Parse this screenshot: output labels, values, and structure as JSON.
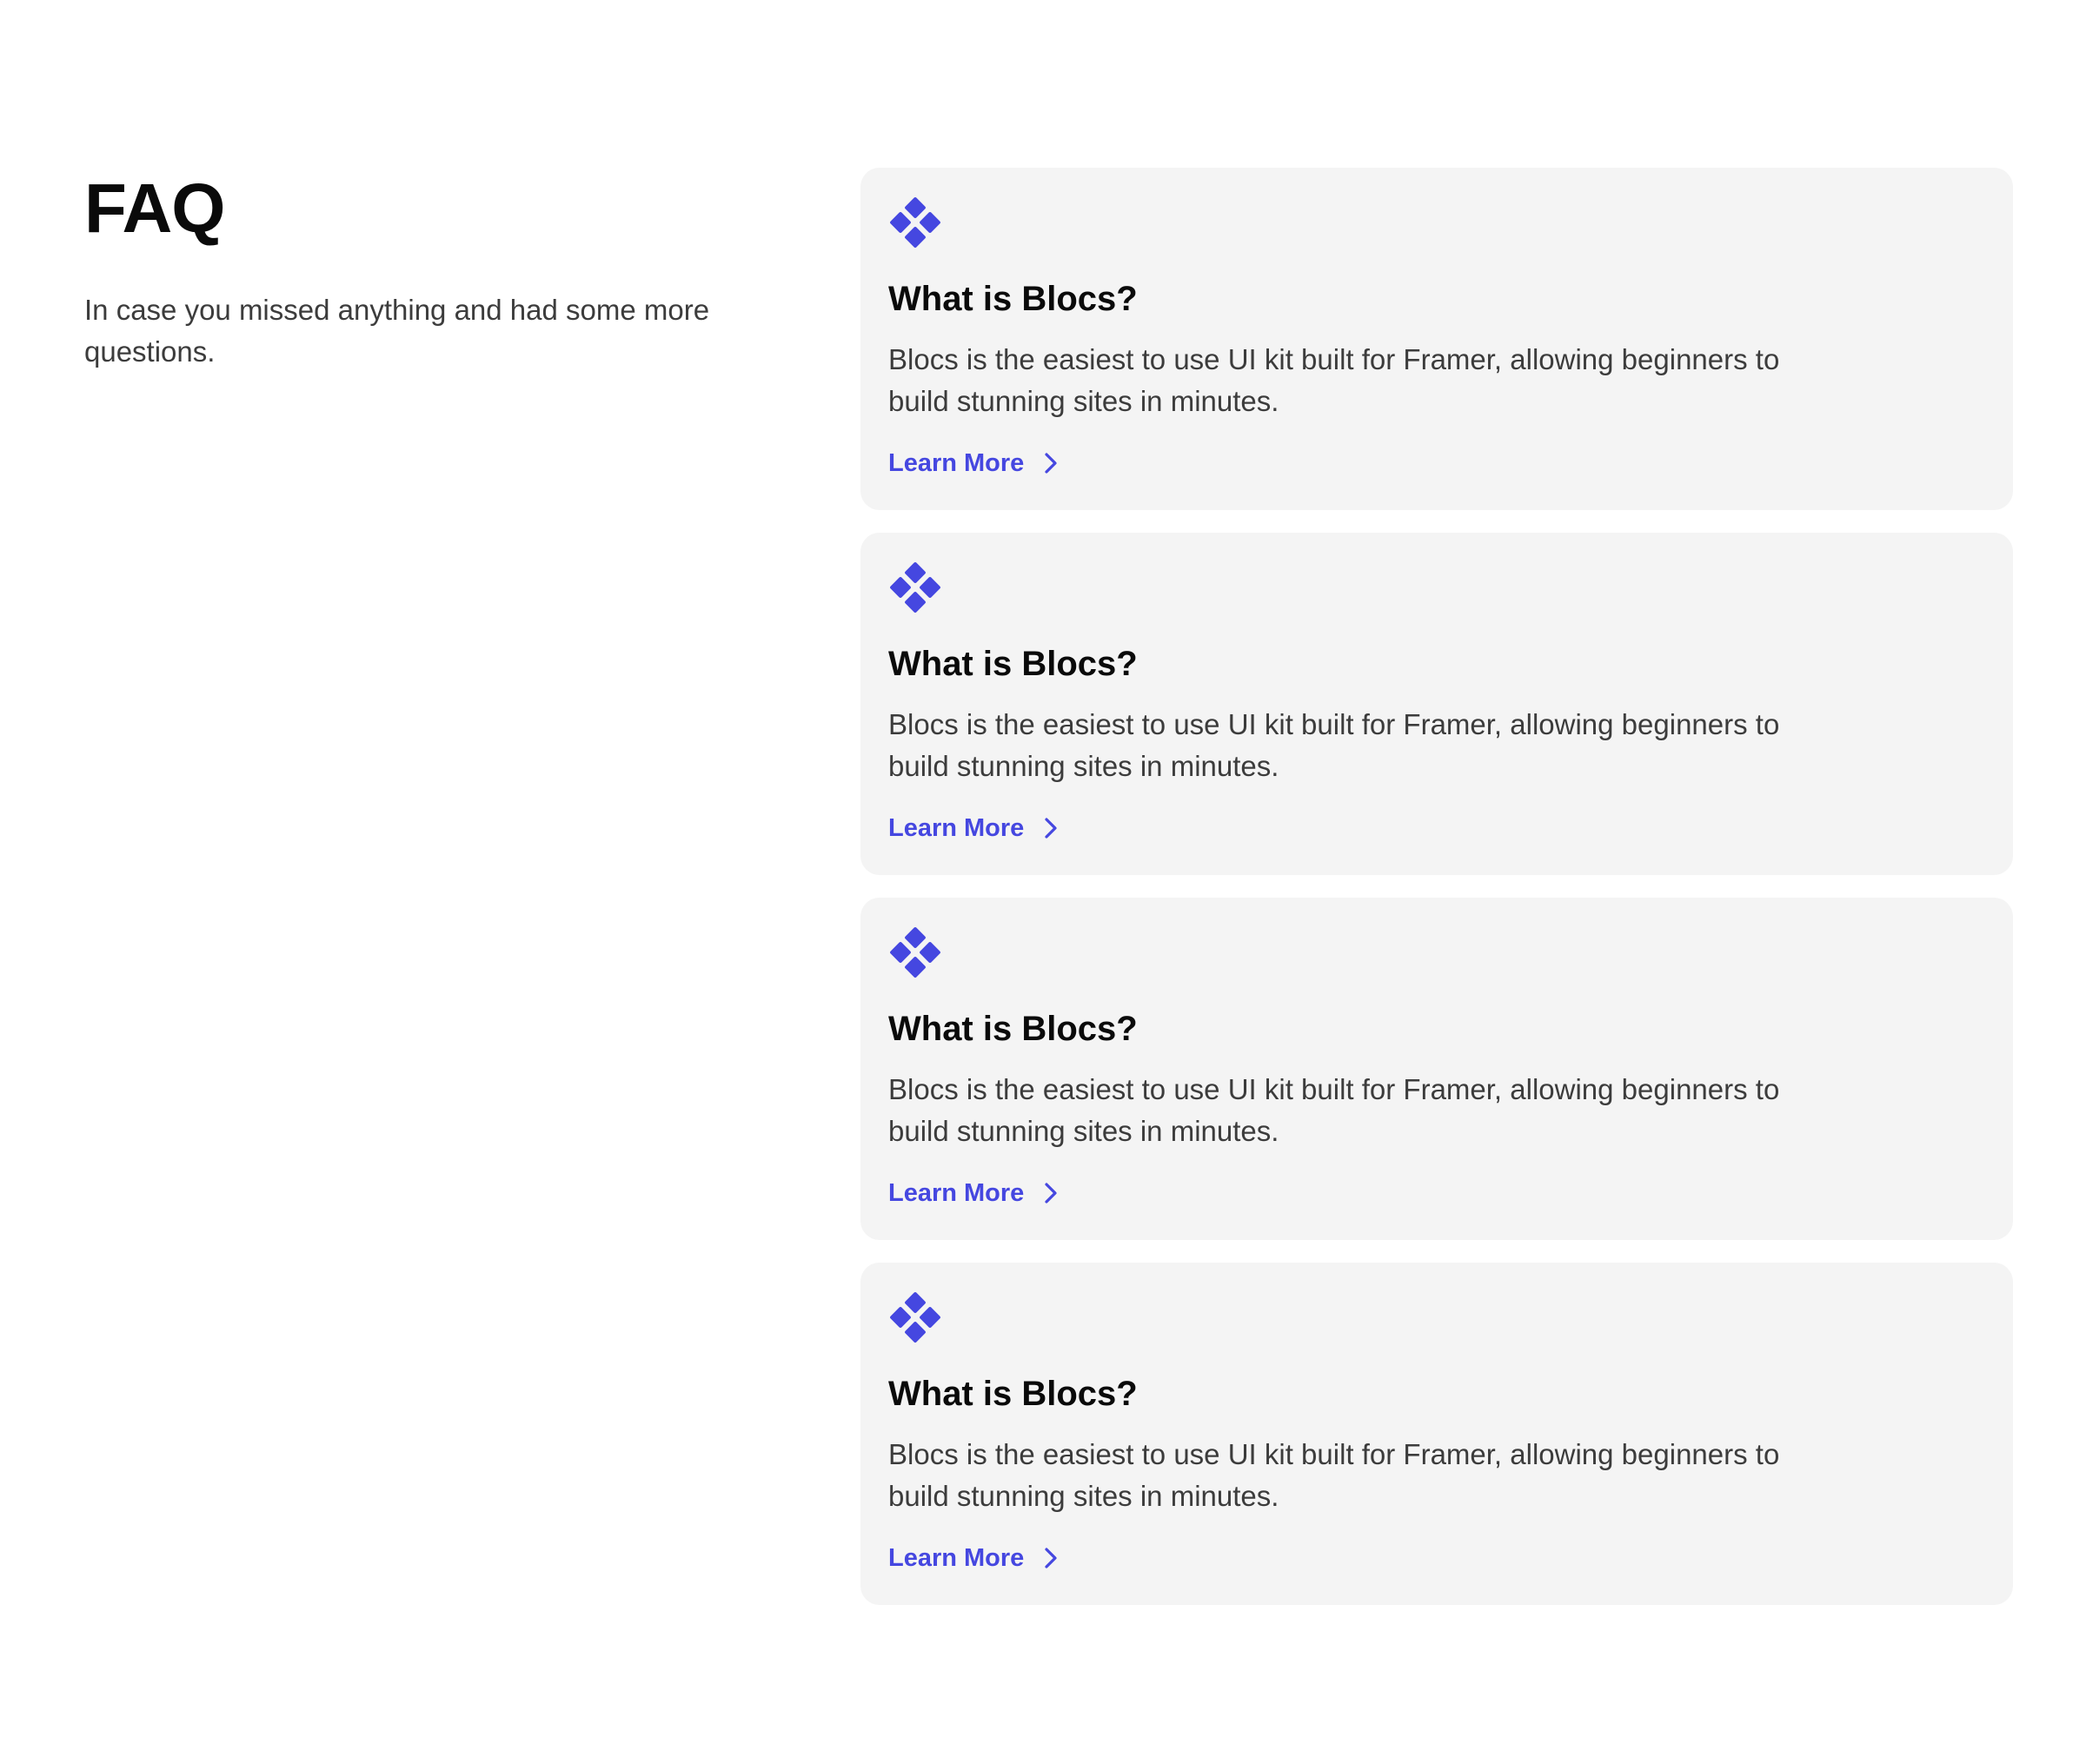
{
  "header": {
    "title": "FAQ",
    "subtitle": "In case you missed anything and had some more questions."
  },
  "accent_color": "#4547e0",
  "faq": [
    {
      "icon": "diamond-cluster-icon",
      "question": "What is Blocs?",
      "answer": "Blocs is the easiest to use UI kit built for Framer, allowing beginners to build stunning sites in minutes.",
      "link_label": "Learn More"
    },
    {
      "icon": "diamond-cluster-icon",
      "question": "What is Blocs?",
      "answer": "Blocs is the easiest to use UI kit built for Framer, allowing beginners to build stunning sites in minutes.",
      "link_label": "Learn More"
    },
    {
      "icon": "diamond-cluster-icon",
      "question": "What is Blocs?",
      "answer": "Blocs is the easiest to use UI kit built for Framer, allowing beginners to build stunning sites in minutes.",
      "link_label": "Learn More"
    },
    {
      "icon": "diamond-cluster-icon",
      "question": "What is Blocs?",
      "answer": "Blocs is the easiest to use UI kit built for Framer, allowing beginners to build stunning sites in minutes.",
      "link_label": "Learn More"
    }
  ]
}
